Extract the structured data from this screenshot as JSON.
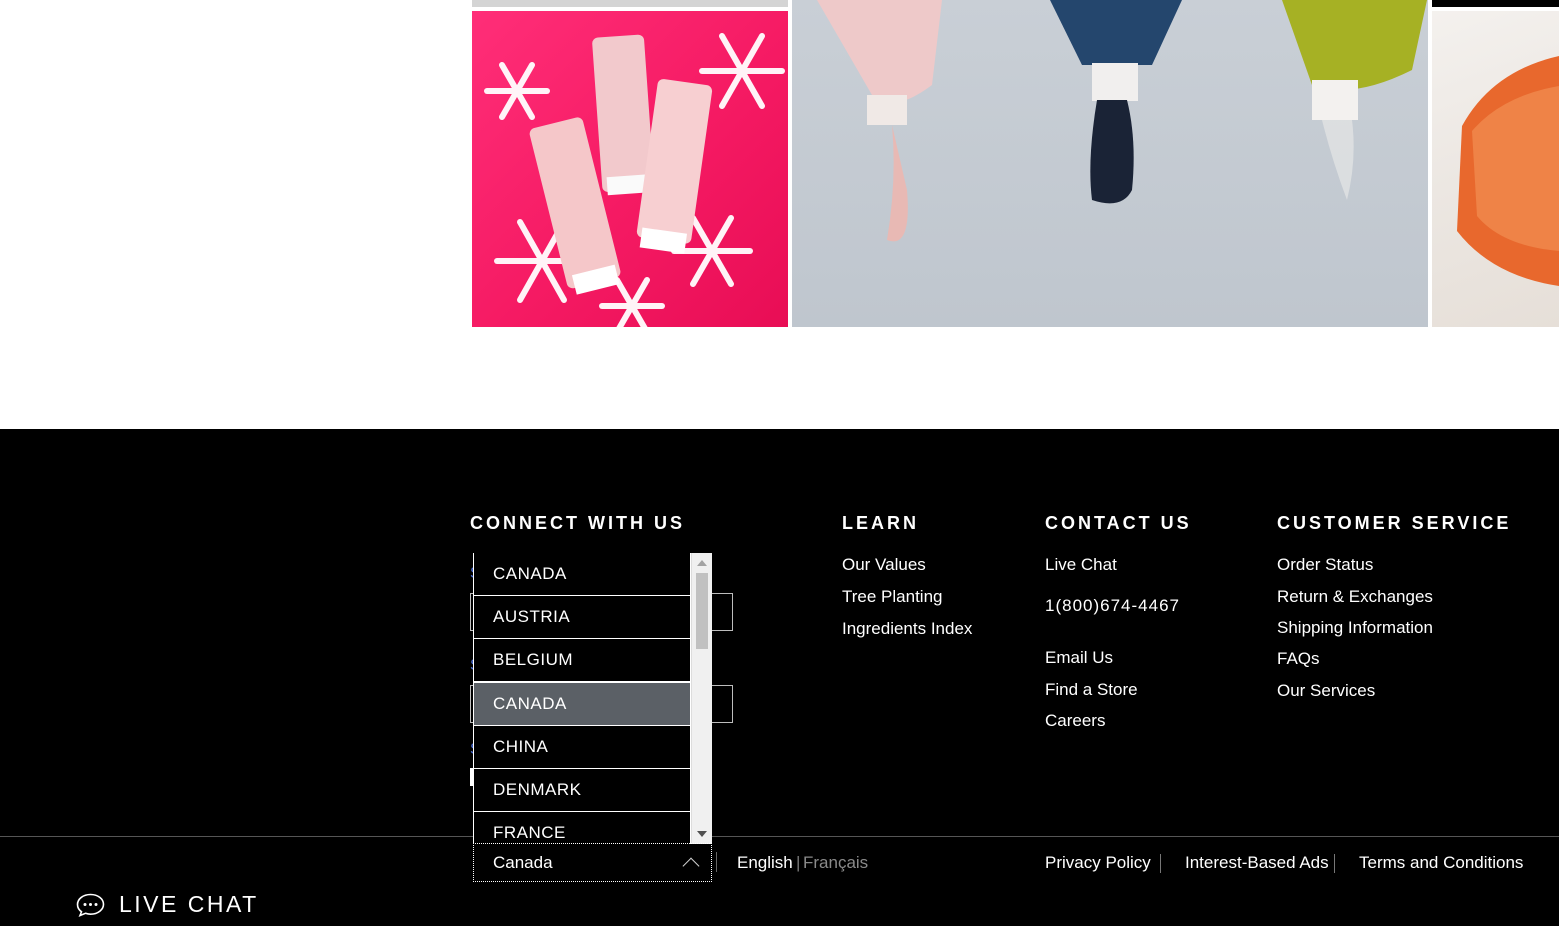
{
  "images": {
    "pink_alt": "Origins Original Skin masks on pink background with snowflakes",
    "tubes_alt": "Origins product tubes squeezed",
    "orange_alt": "GinZing Oil-Free Energy-Boosting Gel Moisturizer"
  },
  "footer": {
    "connect": {
      "title": "CONNECT WITH US"
    },
    "learn": {
      "title": "LEARN",
      "links": [
        "Our Values",
        "Tree Planting",
        "Ingredients Index"
      ]
    },
    "contact": {
      "title": "CONTACT US",
      "live_chat": "Live Chat",
      "phone": "1(800)674-4467",
      "links": [
        "Email Us",
        "Find a Store",
        "Careers"
      ]
    },
    "service": {
      "title": "CUSTOMER SERVICE",
      "links": [
        "Order Status",
        "Return & Exchanges",
        "Shipping Information",
        "FAQs",
        "Our Services"
      ]
    },
    "country_dropdown": {
      "options": [
        "CANADA",
        "AUSTRIA",
        "BELGIUM",
        "CANADA",
        "CHINA",
        "DENMARK",
        "FRANCE"
      ],
      "selected_index": 3
    },
    "country_select": {
      "value": "Canada"
    },
    "language": {
      "english": "English",
      "separator": "|",
      "french": "Français"
    },
    "legal": {
      "privacy": "Privacy Policy",
      "interest_ads": "Interest-Based Ads",
      "terms": "Terms and Conditions"
    },
    "live_chat_button": "LIVE CHAT"
  },
  "colors": {
    "footer_bg": "#000000",
    "selected_option": "#5b6066",
    "accent_pink": "#f51a63"
  }
}
